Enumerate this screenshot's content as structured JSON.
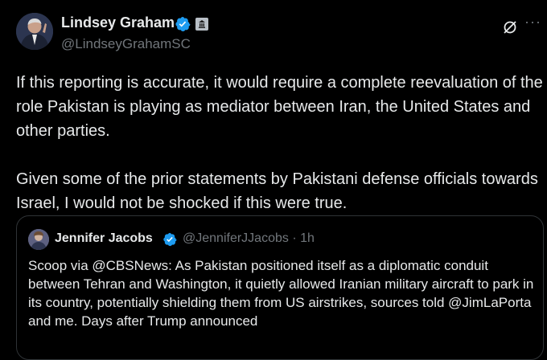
{
  "post": {
    "author_name": "Lindsey Graham",
    "author_handle": "@LindseyGrahamSC",
    "paragraphs": [
      "If this reporting is accurate, it would require a complete reevaluation of the role Pakistan is playing as mediator between Iran, the United States and other parties.",
      "Given some of the prior statements by Pakistani defense officials towards Israel, I would not be shocked if this were true."
    ],
    "more_label": "···"
  },
  "quoted_post": {
    "author_name": "Jennifer Jacobs",
    "author_handle": "@JenniferJJacobs",
    "separator": "·",
    "time": "1h",
    "text": "Scoop via @CBSNews: As Pakistan positioned itself as a diplomatic conduit between Tehran and Washington, it quietly allowed Iranian military aircraft to park in its country, potentially shielding them from US airstrikes, sources told @JimLaPorta and me. Days after Trump announced"
  },
  "icons": {
    "verified_badge": "verified-check-icon",
    "gov_badge": "government-affiliation-icon",
    "grok": "grok-icon",
    "more": "more-options-icon"
  },
  "colors": {
    "background": "#000000",
    "text_primary": "#e7e9ea",
    "text_secondary": "#71767b",
    "verified_blue": "#1d9bf0",
    "border": "#2f3336"
  }
}
